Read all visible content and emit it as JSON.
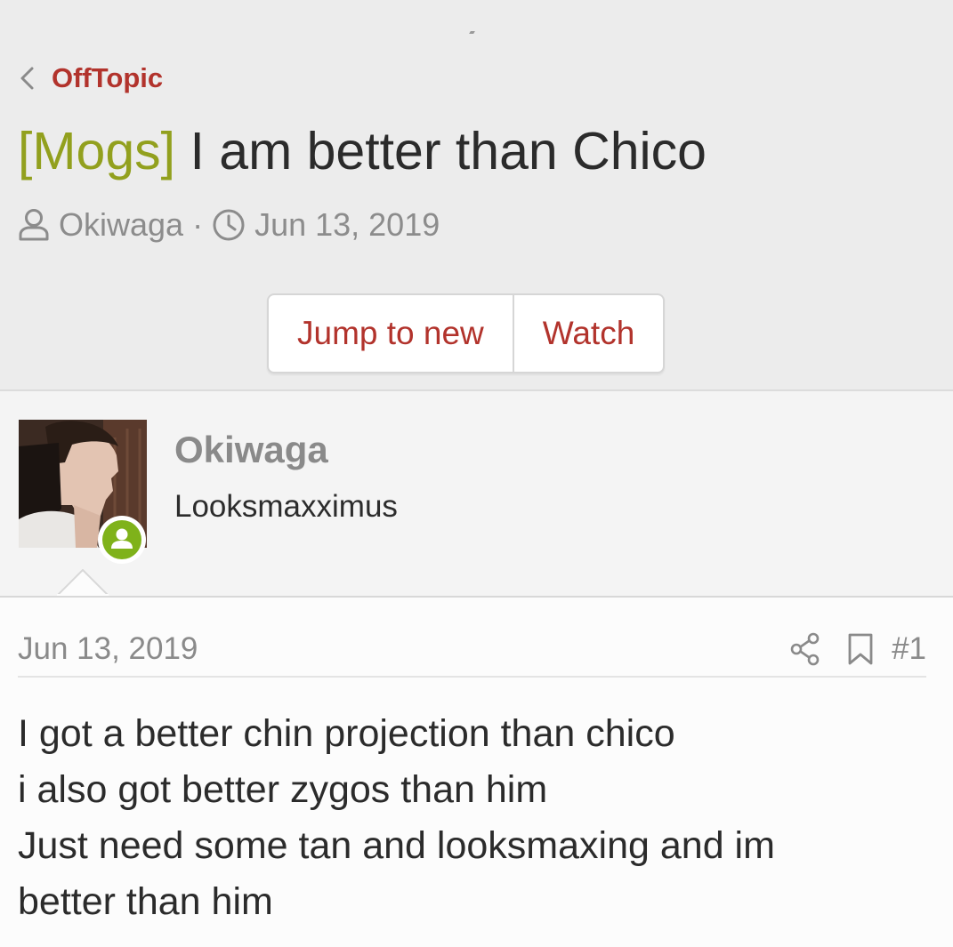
{
  "breadcrumb": {
    "label": "OffTopic"
  },
  "thread": {
    "prefix": "[Mogs]",
    "title": "I am better than Chico",
    "author": "Okiwaga",
    "separator": "·",
    "date": "Jun 13, 2019"
  },
  "actions": {
    "jump_to_new": "Jump to new",
    "watch": "Watch"
  },
  "post": {
    "author_name": "Okiwaga",
    "author_title": "Looksmaxximus",
    "date": "Jun 13, 2019",
    "number": "#1",
    "lines": [
      "I got a better chin projection than chico",
      "i also got better zygos than him",
      "Just need some tan and looksmaxing and im",
      "better than him"
    ]
  },
  "colors": {
    "accent_red": "#b2332c",
    "prefix_green": "#92a01e",
    "online_green": "#7fb21a",
    "header_bg": "#ececec"
  },
  "icons": [
    "chevron-left-icon",
    "user-icon",
    "clock-icon",
    "share-icon",
    "bookmark-icon",
    "online-status-icon"
  ]
}
